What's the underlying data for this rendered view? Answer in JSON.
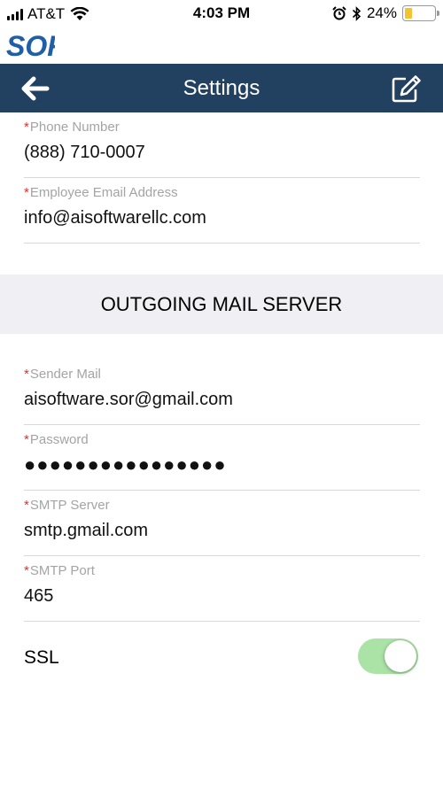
{
  "status_bar": {
    "carrier": "AT&T",
    "time": "4:03 PM",
    "battery_percent": "24%",
    "battery_level": 0.24,
    "icons": [
      "signal-icon",
      "wifi-icon",
      "alarm-icon",
      "bluetooth-icon",
      "battery-icon"
    ]
  },
  "logo": {
    "text": "SOR",
    "color": "#1e5fa8"
  },
  "navbar": {
    "title": "Settings",
    "background": "#22405f",
    "back_icon": "arrow-left-icon",
    "edit_icon": "edit-icon"
  },
  "fields_top": [
    {
      "label": "Phone Number",
      "value": "(888) 710-0007"
    },
    {
      "label": "Employee Email Address",
      "value": "info@aisoftwarellc.com"
    }
  ],
  "section": {
    "title": "OUTGOING MAIL SERVER"
  },
  "fields_mail": [
    {
      "label": "Sender Mail",
      "value": "aisoftware.sor@gmail.com"
    },
    {
      "label": "Password",
      "value": "●●●●●●●●●●●●●●●●"
    },
    {
      "label": "SMTP Server",
      "value": "smtp.gmail.com"
    },
    {
      "label": "SMTP Port",
      "value": "465"
    }
  ],
  "required_marker": "*",
  "ssl": {
    "label": "SSL",
    "enabled": true,
    "on_color": "#abe2a6"
  }
}
